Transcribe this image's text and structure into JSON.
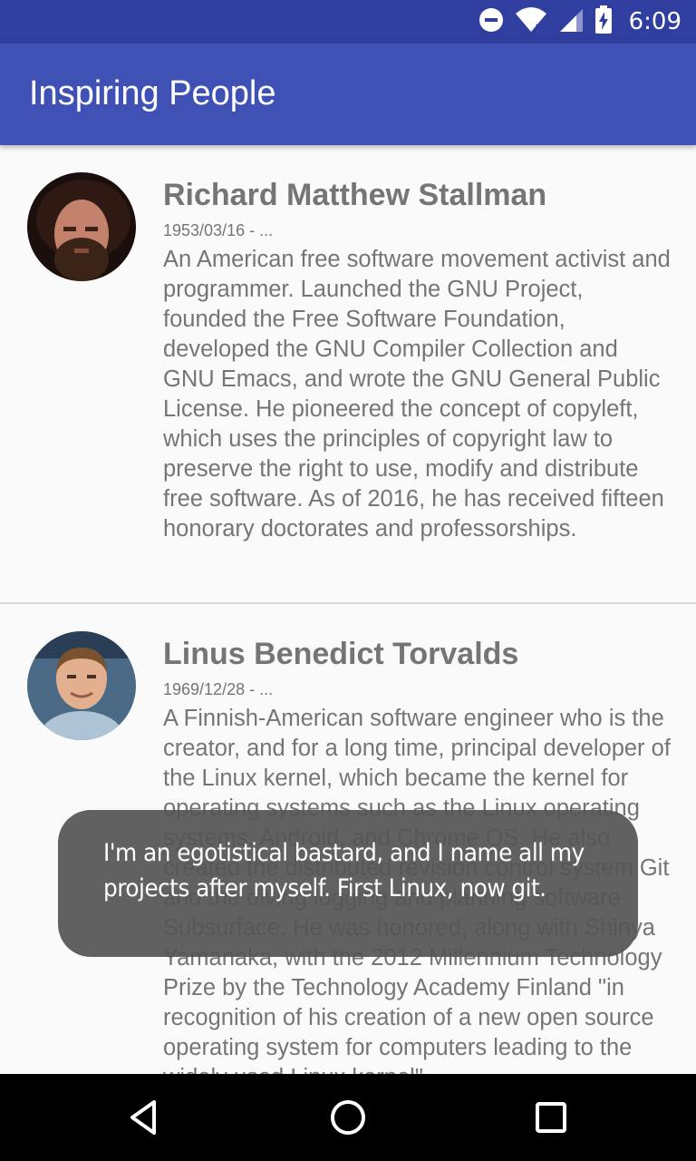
{
  "status_bar": {
    "time": "6:09",
    "icons": [
      "do-not-disturb-icon",
      "wifi-icon",
      "cell-signal-icon",
      "battery-charging-icon"
    ]
  },
  "app_bar": {
    "title": "Inspiring People"
  },
  "people": [
    {
      "name": "Richard Matthew Stallman",
      "dates": "1953/03/16 - ...",
      "bio": "An American free software movement activist and programmer. Launched the GNU Project, founded the Free Software Foundation, developed the GNU Compiler Collection and GNU Emacs, and wrote the GNU General Public License. He pioneered the concept of copyleft, which uses the principles of copyright law to preserve the right to use, modify and distribute free software. As of 2016, he has received fifteen honorary doctorates and professorships."
    },
    {
      "name": "Linus Benedict Torvalds",
      "dates": "1969/12/28 - ...",
      "bio": "A Finnish-American software engineer who is the creator, and for a long time, principal developer of the Linux kernel, which became the kernel for operating systems such as the Linux operating systems, Android, and Chrome OS. He also created the distributed revision control system Git and the diving logging and planning software Subsurface. He was honored, along with Shinya Yamanaka, with the 2012 Millennium Technology Prize by the Technology Academy Finland \"in recognition of his creation of a new open source operating system for computers leading to the widely used Linux kernel\"."
    }
  ],
  "toast": {
    "text": "I'm an egotistical bastard, and I name all my projects after myself. First Linux, now git."
  },
  "nav_bar": {
    "icons": [
      "back-icon",
      "home-icon",
      "recents-icon"
    ]
  },
  "colors": {
    "status_bar": "#303f9f",
    "app_bar": "#3f51b5",
    "text_secondary": "#757575",
    "background": "#fafafa"
  }
}
